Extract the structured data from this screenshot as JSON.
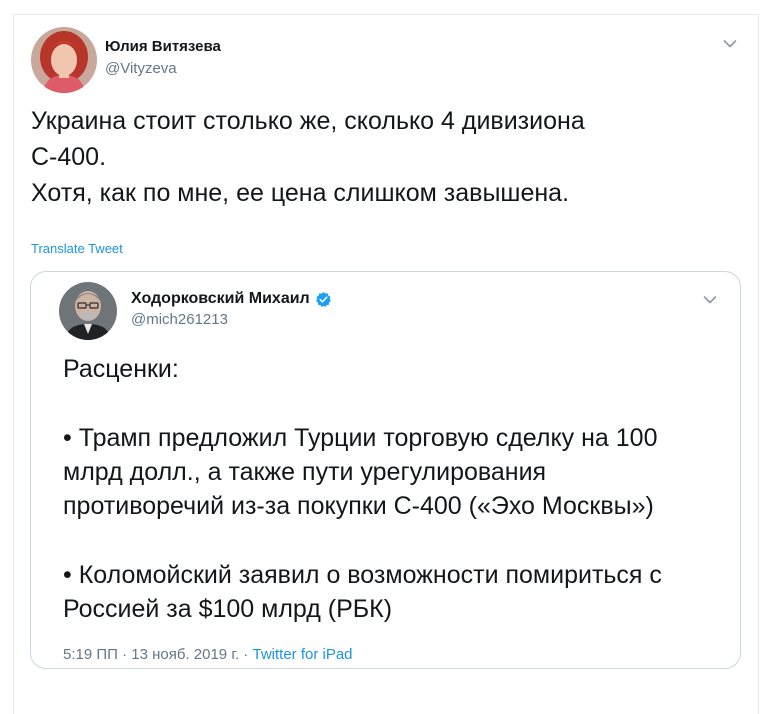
{
  "tweet": {
    "author_name": "Юлия Витязева",
    "author_handle": "@Vityzeva",
    "text_lines": [
      "Украина стоит столько же, сколько 4 дивизиона",
      "С-400.",
      "Хотя, как по мне, ее цена слишком завышена."
    ],
    "translate_label": "Translate Tweet"
  },
  "quoted": {
    "author_name": "Ходорковский Михаил",
    "author_handle": "@mich261213",
    "verified": true,
    "paragraphs": [
      {
        "lines": [
          "Расценки:"
        ]
      },
      {
        "lines": [
          "• Трамп предложил Турции торговую сделку на 100",
          "млрд долл., а также пути урегулирования",
          "противоречий из-за покупки С-400 («Эхо Москвы»)"
        ]
      },
      {
        "lines": [
          "• Коломойский заявил о возможности помириться с",
          "Россией за $100 млрд (РБК)"
        ]
      }
    ],
    "timestamp": "5:19 ПП · 13 нояб. 2019 г.",
    "separator": " · ",
    "source": "Twitter for iPad"
  },
  "icons": {
    "chevron": "chevron-down-icon",
    "verified": "verified-badge-icon"
  },
  "colors": {
    "link": "#1b95e0",
    "secondary_text": "#657786",
    "border": "#ccd6dd",
    "verified": "#1da1f2"
  }
}
